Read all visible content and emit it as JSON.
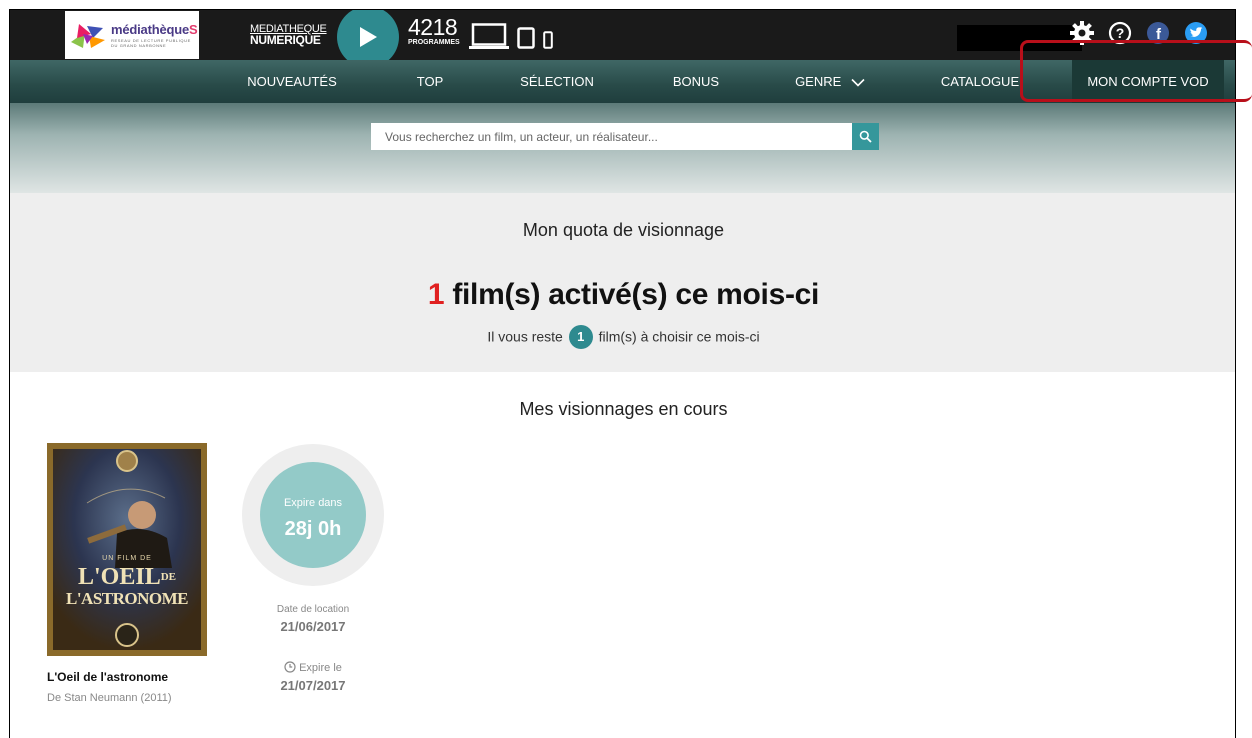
{
  "header": {
    "logo": {
      "name": "médiathèque",
      "name_suffix": "S",
      "subtitle": "RESEAU DE LECTURE PUBLIQUE DU GRAND NARBONNE"
    },
    "mn_line1": "MEDIATHEQUE",
    "mn_line2": "NUMERIQUE",
    "play_icon": "play-icon",
    "programs_count": "4218",
    "programs_label": "PROGRAMMES",
    "device_icons": [
      "laptop-icon",
      "tablet-icon",
      "phone-icon"
    ],
    "right_icons": [
      "gear-icon",
      "help-icon",
      "facebook-icon",
      "twitter-icon"
    ],
    "colors": {
      "teal": "#2e8a8f",
      "bar": "#1a1a1a",
      "highlight": "#b80f1a",
      "accent_red": "#e02020"
    }
  },
  "nav": {
    "items": [
      "NOUVEAUTÉS",
      "TOP",
      "SÉLECTION",
      "BONUS",
      "GENRE",
      "CATALOGUE",
      "MON COMPTE VOD"
    ],
    "genre_icon": "chevron-down-icon"
  },
  "search": {
    "placeholder": "Vous recherchez un film, un acteur, un réalisateur...",
    "button_icon": "search-icon"
  },
  "quota": {
    "title": "Mon quota de visionnage",
    "count": "1",
    "main_text": " film(s) activé(s) ce mois-ci",
    "remaining_prefix": "Il vous reste",
    "remaining_count": "1",
    "remaining_suffix": "film(s) à choisir ce mois-ci"
  },
  "current": {
    "title": "Mes visionnages en cours",
    "film": {
      "poster_top_text": "UN FILM DE",
      "poster_title_1": "L'OEIL",
      "poster_title_de": "DE",
      "poster_title_2": "L'ASTRONOME",
      "title": "L'Oeil de l'astronome",
      "byline": "De Stan Neumann (2011)"
    },
    "expire_label": "Expire dans",
    "expire_value": "28j 0h",
    "rent_label": "Date de location",
    "rent_date": "21/06/2017",
    "expire_on_label": "Expire le",
    "expire_on_date": "21/07/2017",
    "clock_icon": "clock-icon"
  }
}
